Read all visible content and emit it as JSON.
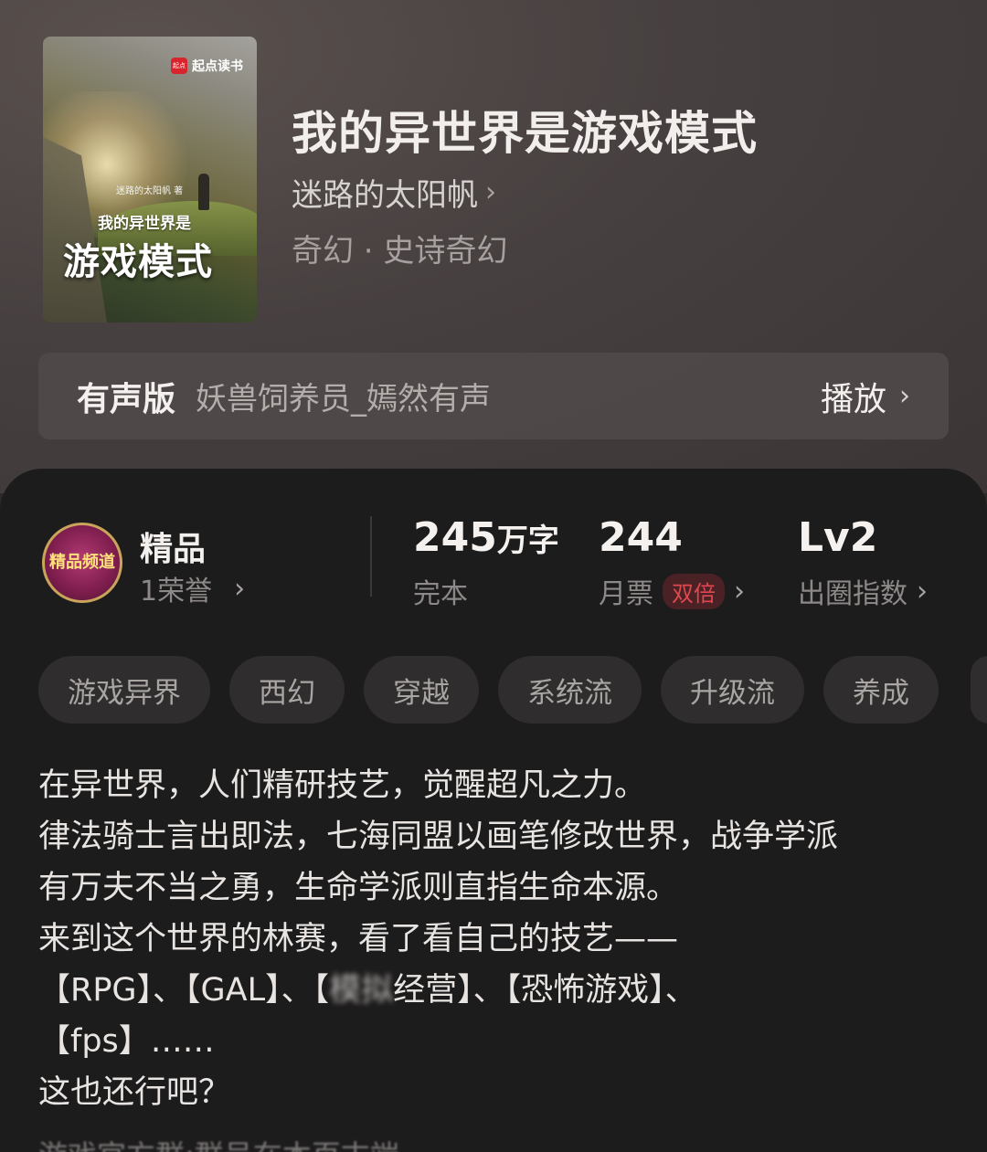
{
  "book": {
    "cover": {
      "logo_text": "起点读书",
      "logo_mark": "起点",
      "author_small": "迷路的太阳帆 著",
      "title_line1": "我的异世界是",
      "title_line2": "游戏模式"
    },
    "title": "我的异世界是游戏模式",
    "author": "迷路的太阳帆",
    "genre": "奇幻 · 史诗奇幻"
  },
  "audio": {
    "label": "有声版",
    "narrator": "妖兽饲养员_嫣然有声",
    "play_label": "播放"
  },
  "stats": {
    "quality_title": "精品",
    "honors": "1荣誉",
    "badge_text": "精品频道",
    "words_num": "245",
    "words_unit": "万字",
    "status": "完本",
    "tickets_num": "244",
    "tickets_label": "月票",
    "double_tag": "双倍",
    "level": "Lv2",
    "index_label": "出圈指数"
  },
  "tags": [
    "游戏异界",
    "西幻",
    "穿越",
    "系统流",
    "升级流",
    "养成"
  ],
  "description": {
    "line1": "在异世界，人们精研技艺，觉醒超凡之力。",
    "line2": "律法骑士言出即法，七海同盟以画笔修改世界，战争学派",
    "line3": "有万夫不当之勇，生命学派则直指生命本源。",
    "line4": "来到这个世界的林赛，看了看自己的技艺——",
    "line5_a": "【RPG】、【GAL】、【",
    "line5_blur": "模拟",
    "line5_b": "经营】、【恐怖游戏】、",
    "line6": "【fps】……",
    "line7": "这也还行吧？",
    "next": "游戏官方群:群号在本页末端"
  },
  "colors": {
    "accent_red": "#e0474f",
    "panel_bg": "#1d1c1c",
    "header_bg": "#47403f"
  },
  "icons": [
    "chevron-right-icon",
    "quality-badge-icon",
    "qidian-logo-icon"
  ]
}
